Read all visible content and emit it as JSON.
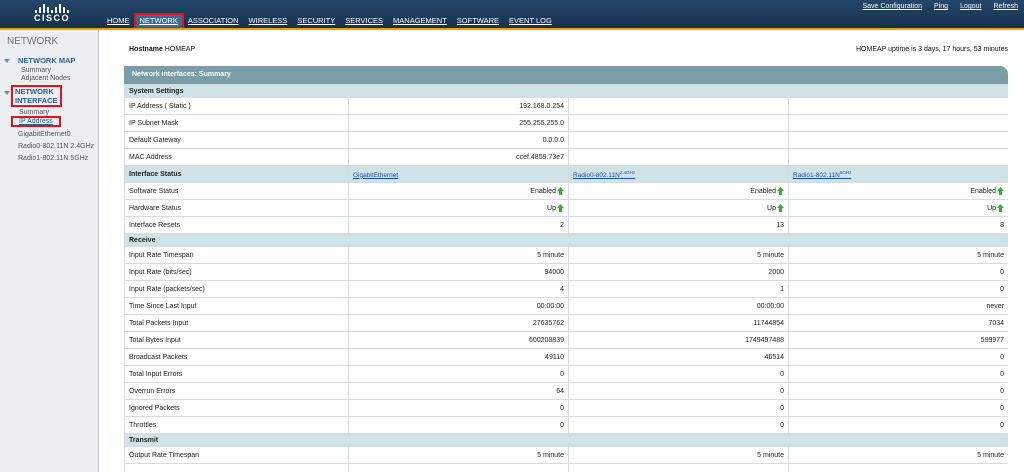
{
  "brand": {
    "logo_text": "CISCO"
  },
  "nav": {
    "tabs": [
      {
        "label": "HOME",
        "active": false
      },
      {
        "label": "NETWORK",
        "active": true
      },
      {
        "label": "ASSOCIATION",
        "active": false
      },
      {
        "label": "WIRELESS",
        "active": false
      },
      {
        "label": "SECURITY",
        "active": false
      },
      {
        "label": "SERVICES",
        "active": false
      },
      {
        "label": "MANAGEMENT",
        "active": false
      },
      {
        "label": "SOFTWARE",
        "active": false
      },
      {
        "label": "EVENT LOG",
        "active": false
      }
    ],
    "util": [
      "Save Configuration",
      "Ping",
      "Logout",
      "Refresh"
    ]
  },
  "sidebar": {
    "title": "NETWORK",
    "network_map": {
      "label": "NETWORK MAP",
      "items": [
        "Summary",
        "Adjacent Nodes"
      ]
    },
    "network_interface": {
      "label_line1": "NETWORK",
      "label_line2": "INTERFACE",
      "items": [
        "Summary",
        "IP Address"
      ]
    },
    "interfaces": [
      "GigabitEthernet0",
      "Radio0-802.11N 2.4GHz",
      "Radio1-802.11N 5GHz"
    ]
  },
  "header": {
    "hostname_label": "Hostname",
    "hostname_value": "HOMEAP",
    "uptime": "HOMEAP uptime is 3 days, 17 hours, 53 minutes"
  },
  "panel": {
    "title": "Network Interfaces: Summary",
    "system_settings": {
      "label": "System Settings",
      "rows": [
        {
          "label": "IP Address ( Static )",
          "value": "192.168.0.254"
        },
        {
          "label": "IP Subnet Mask",
          "value": "255.255.255.0"
        },
        {
          "label": "Default Gateway",
          "value": "0.0.0.0"
        },
        {
          "label": "MAC Address",
          "value": "ccef.4859.73e7"
        }
      ]
    },
    "interface_status": {
      "label": "Interface Status",
      "interfaces": [
        {
          "name": "GigabitEthernet",
          "sup": ""
        },
        {
          "name": "Radio0-802.11N",
          "sup": "2.4GHz"
        },
        {
          "name": "Radio1-802.11N",
          "sup": "5GHz"
        }
      ],
      "rows": [
        {
          "label": "Software Status",
          "values": [
            "Enabled",
            "Enabled",
            "Enabled"
          ]
        },
        {
          "label": "Hardware Status",
          "values": [
            "Up",
            "Up",
            "Up"
          ]
        },
        {
          "label": "Interface Resets",
          "values": [
            "2",
            "13",
            "8"
          ]
        }
      ]
    },
    "receive": {
      "label": "Receive",
      "rows": [
        {
          "label": "Input Rate Timespan",
          "values": [
            "5 minute",
            "5 minute",
            "5 minute"
          ]
        },
        {
          "label": "Input Rate (bits/sec)",
          "values": [
            "94000",
            "2000",
            "0"
          ]
        },
        {
          "label": "Input Rate (packets/sec)",
          "values": [
            "4",
            "1",
            "0"
          ]
        },
        {
          "label": "Time Since Last Input",
          "values": [
            "00:00:00",
            "00:00:00",
            "never"
          ]
        },
        {
          "label": "Total Packets Input",
          "values": [
            "27635762",
            "11744854",
            "7034"
          ]
        },
        {
          "label": "Total Bytes Input",
          "values": [
            "600208839",
            "1749497488",
            "599977"
          ]
        },
        {
          "label": "Broadcast Packets",
          "values": [
            "49110",
            "46514",
            "0"
          ]
        },
        {
          "label": "Total Input Errors",
          "values": [
            "0",
            "0",
            "0"
          ]
        },
        {
          "label": "Overrun Errors",
          "values": [
            "64",
            "0",
            "0"
          ]
        },
        {
          "label": "Ignored Packets",
          "values": [
            "0",
            "0",
            "0"
          ]
        },
        {
          "label": "Throttles",
          "values": [
            "0",
            "0",
            "0"
          ]
        }
      ]
    },
    "transmit": {
      "label": "Transmit",
      "rows": [
        {
          "label": "Output Rate Timespan",
          "values": [
            "5 minute",
            "5 minute",
            "5 minute"
          ]
        }
      ]
    }
  },
  "colors": {
    "accent": "#f0a000",
    "highlight": "#e8101d",
    "up_arrow": "#2fb52f"
  }
}
